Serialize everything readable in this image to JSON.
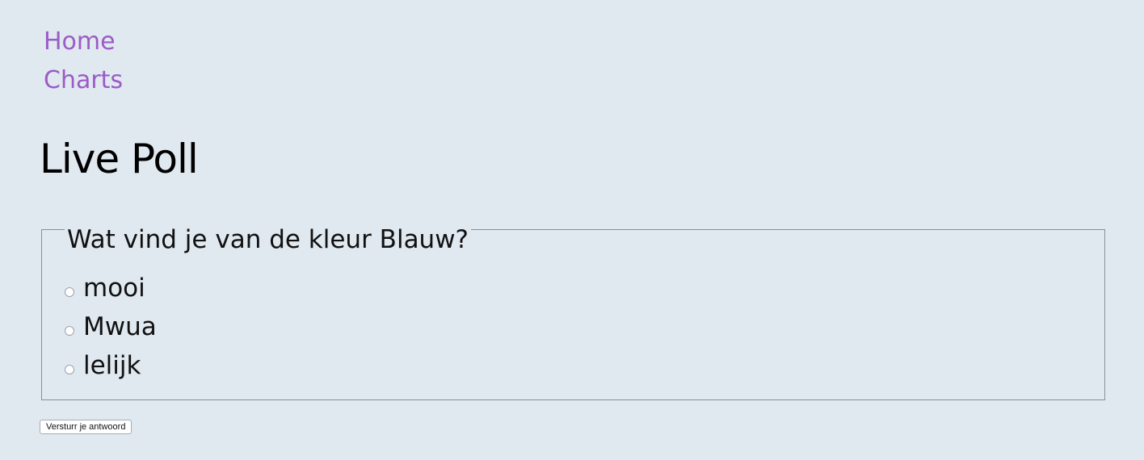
{
  "nav": {
    "home_label": "Home",
    "charts_label": "Charts"
  },
  "page": {
    "title": "Live Poll"
  },
  "poll": {
    "question": "Wat vind je van de kleur Blauw?",
    "options": [
      "mooi",
      "Mwua",
      "lelijk"
    ],
    "submit_label": "Versturr je antwoord"
  },
  "colors": {
    "background": "#e0e8f0",
    "nav_link": "#9b5cc6",
    "text": "#111111"
  }
}
